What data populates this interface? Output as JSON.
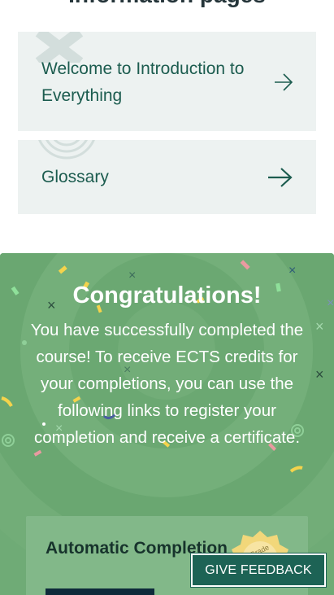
{
  "info_pages": {
    "section_title": "Information pages",
    "items": [
      {
        "label_line1": "Welcome to Introduction to",
        "label_line2": "Everything",
        "icon": "arrow-right-icon"
      },
      {
        "label": "Glossary",
        "icon": "arrow-right-icon"
      }
    ]
  },
  "congrats": {
    "heading": "Congratulations!",
    "body": "You have successfully completed the course! To receive ECTS credits for your completions, you can use the following links to register your completion and receive a certificate."
  },
  "automatic_completion": {
    "title": "Automatic Completion",
    "badge_text": "Grade"
  },
  "feedback_button": {
    "label": "GIVE FEEDBACK"
  },
  "colors": {
    "card_bg": "#edf2f1",
    "link_text": "#1c5c4f",
    "congrats_bg": "#6fab76",
    "feedback_bg": "#1d6355"
  }
}
